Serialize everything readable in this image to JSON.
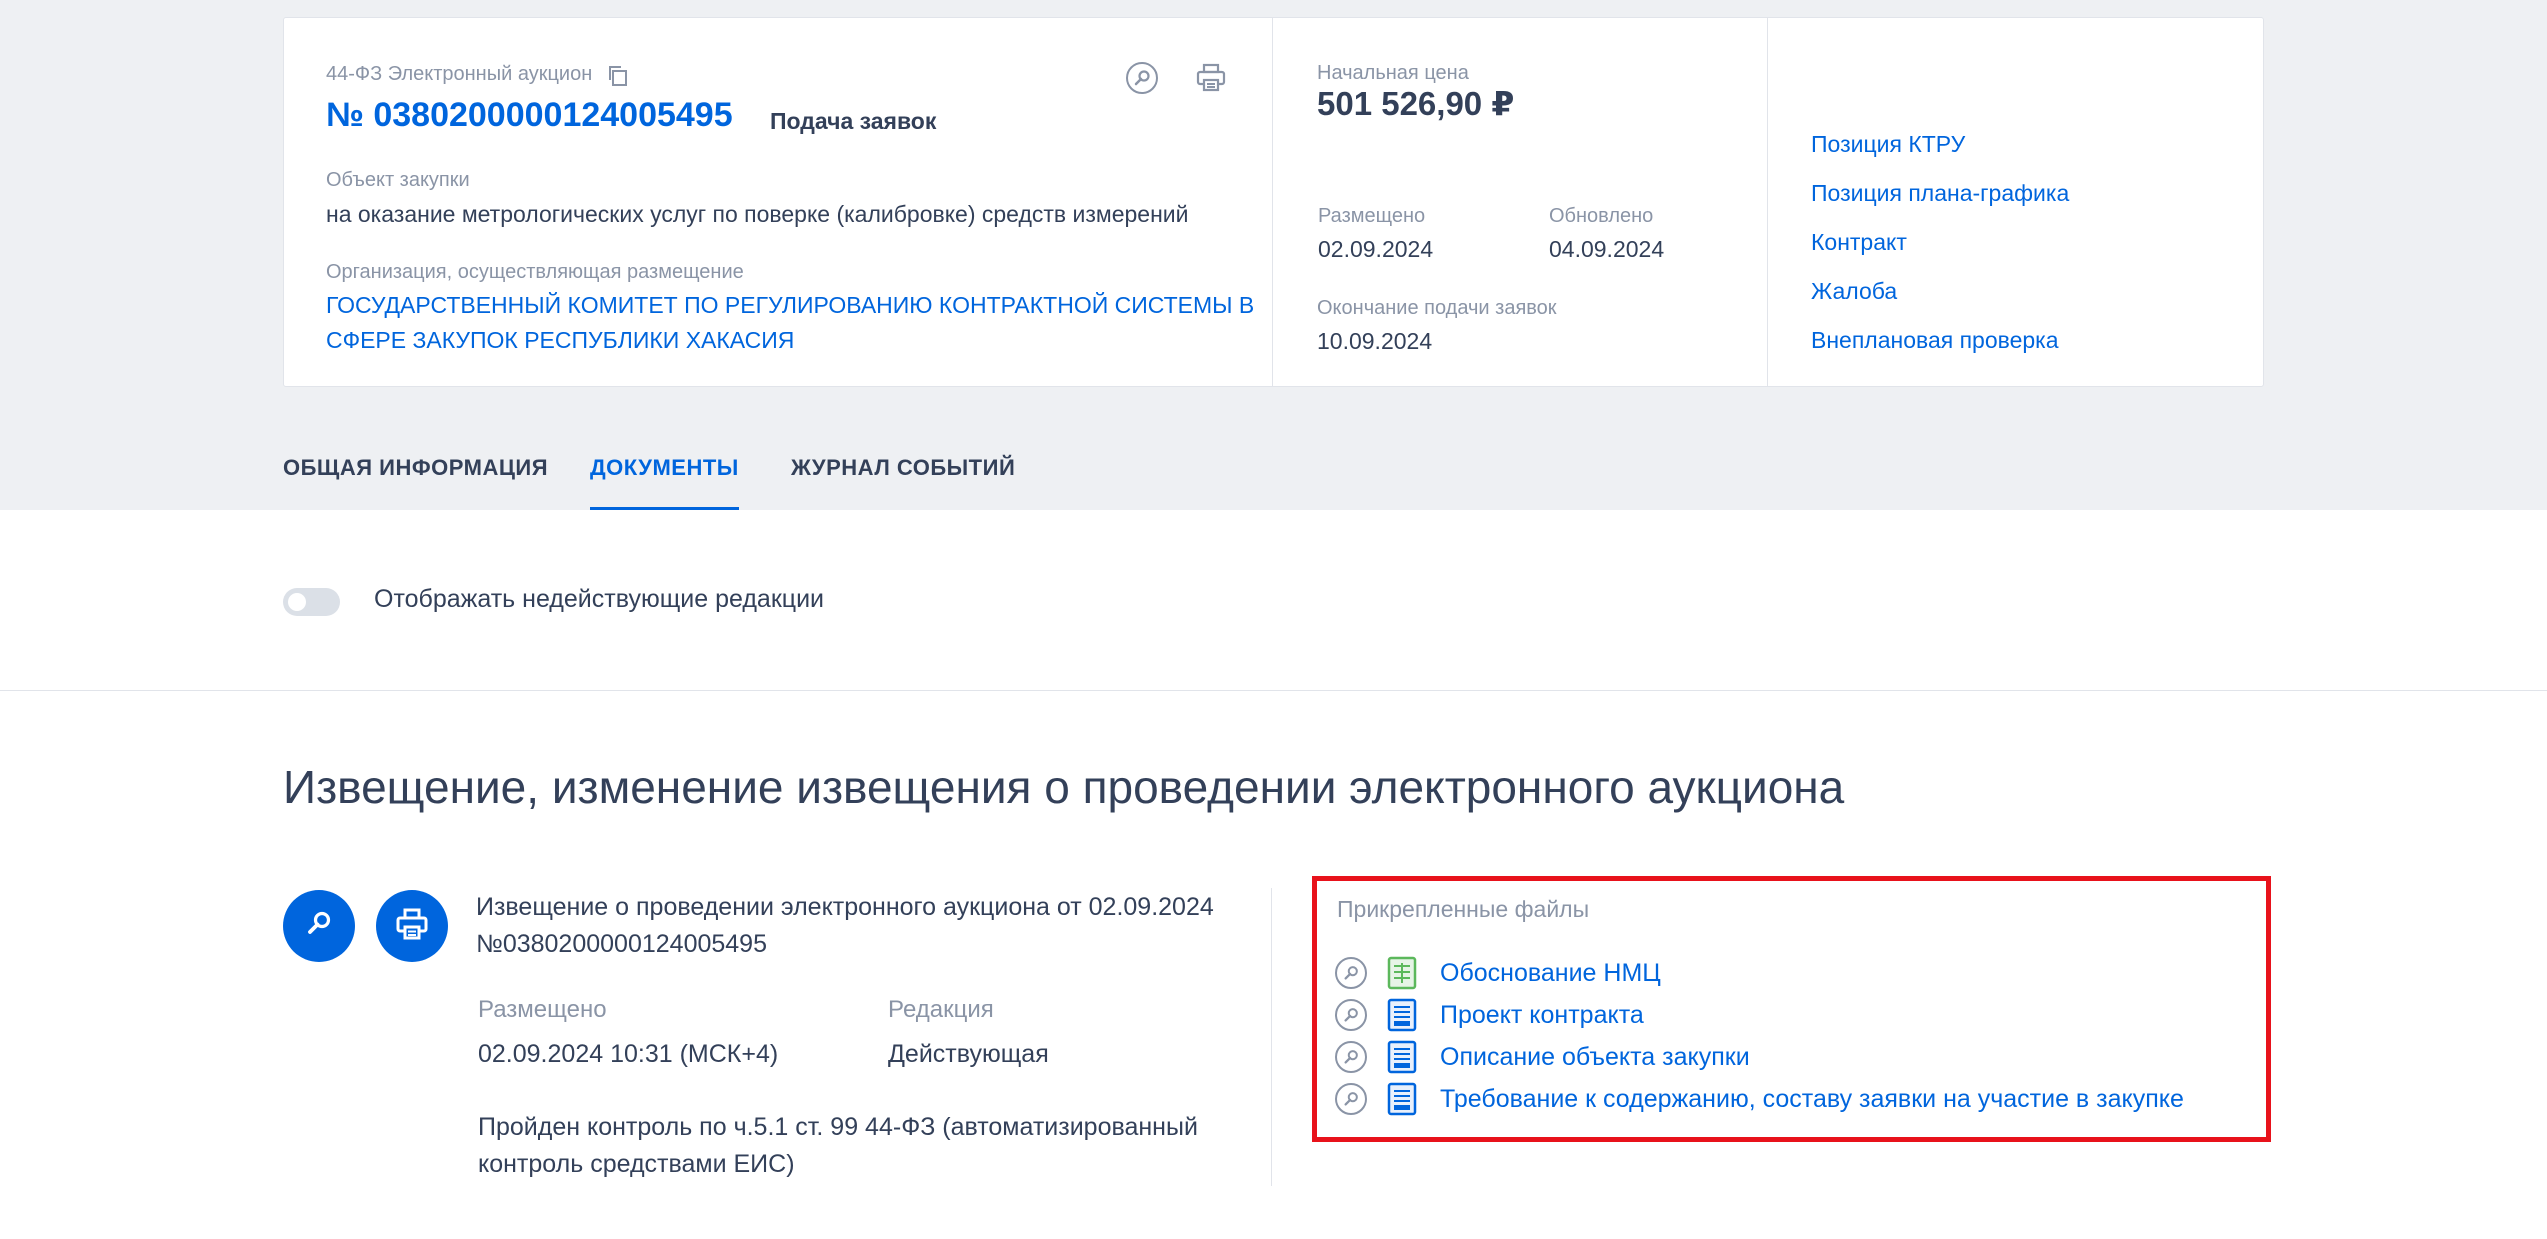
{
  "card": {
    "law_type": "44-ФЗ Электронный аукцион",
    "reg_number": "№ 0380200000124005495",
    "status": "Подача заявок",
    "object_label": "Объект закупки",
    "object_value": "на оказание метрологических услуг по поверке (калибровке) средств измерений",
    "org_label": "Организация, осуществляющая размещение",
    "org_value": "ГОСУДАРСТВЕННЫЙ КОМИТЕТ ПО РЕГУЛИРОВАНИЮ КОНТРАКТНОЙ СИСТЕМЫ В СФЕРЕ ЗАКУПОК РЕСПУБЛИКИ ХАКАСИЯ",
    "price_label": "Начальная цена",
    "price_value": "501 526,90 ₽",
    "posted_label": "Размещено",
    "posted_value": "02.09.2024",
    "updated_label": "Обновлено",
    "updated_value": "04.09.2024",
    "deadline_label": "Окончание подачи заявок",
    "deadline_value": "10.09.2024",
    "links": [
      "Позиция КТРУ",
      "Позиция плана-графика",
      "Контракт",
      "Жалоба",
      "Внеплановая проверка"
    ]
  },
  "tabs": [
    "ОБЩАЯ ИНФОРМАЦИЯ",
    "ДОКУМЕНТЫ",
    "ЖУРНАЛ СОБЫТИЙ"
  ],
  "active_tab": "ДОКУМЕНТЫ",
  "toggle_label": "Отображать недействующие редакции",
  "section_title": "Извещение, изменение извещения о проведении электронного аукциона",
  "notice": {
    "title": "Извещение о проведении электронного аукциона от 02.09.2024 №0380200000124005495",
    "posted_label": "Размещено",
    "posted_value": "02.09.2024 10:31 (МСК+4)",
    "edition_label": "Редакция",
    "edition_value": "Действующая",
    "control_text": "Пройден контроль по ч.5.1 ст. 99 44-ФЗ (автоматизированный контроль средствами ЕИС)"
  },
  "attached": {
    "title": "Прикрепленные файлы",
    "files": [
      {
        "name": "Обоснование НМЦ",
        "type": "spreadsheet"
      },
      {
        "name": "Проект контракта",
        "type": "document"
      },
      {
        "name": "Описание объекта закупки",
        "type": "document"
      },
      {
        "name": "Требование к содержанию, составу заявки на участие в закупке",
        "type": "document"
      }
    ]
  },
  "colors": {
    "accent": "#0065dd",
    "highlight_border": "#e8121b",
    "spreadsheet_icon": "#5cb85c",
    "document_icon": "#0065dd"
  }
}
